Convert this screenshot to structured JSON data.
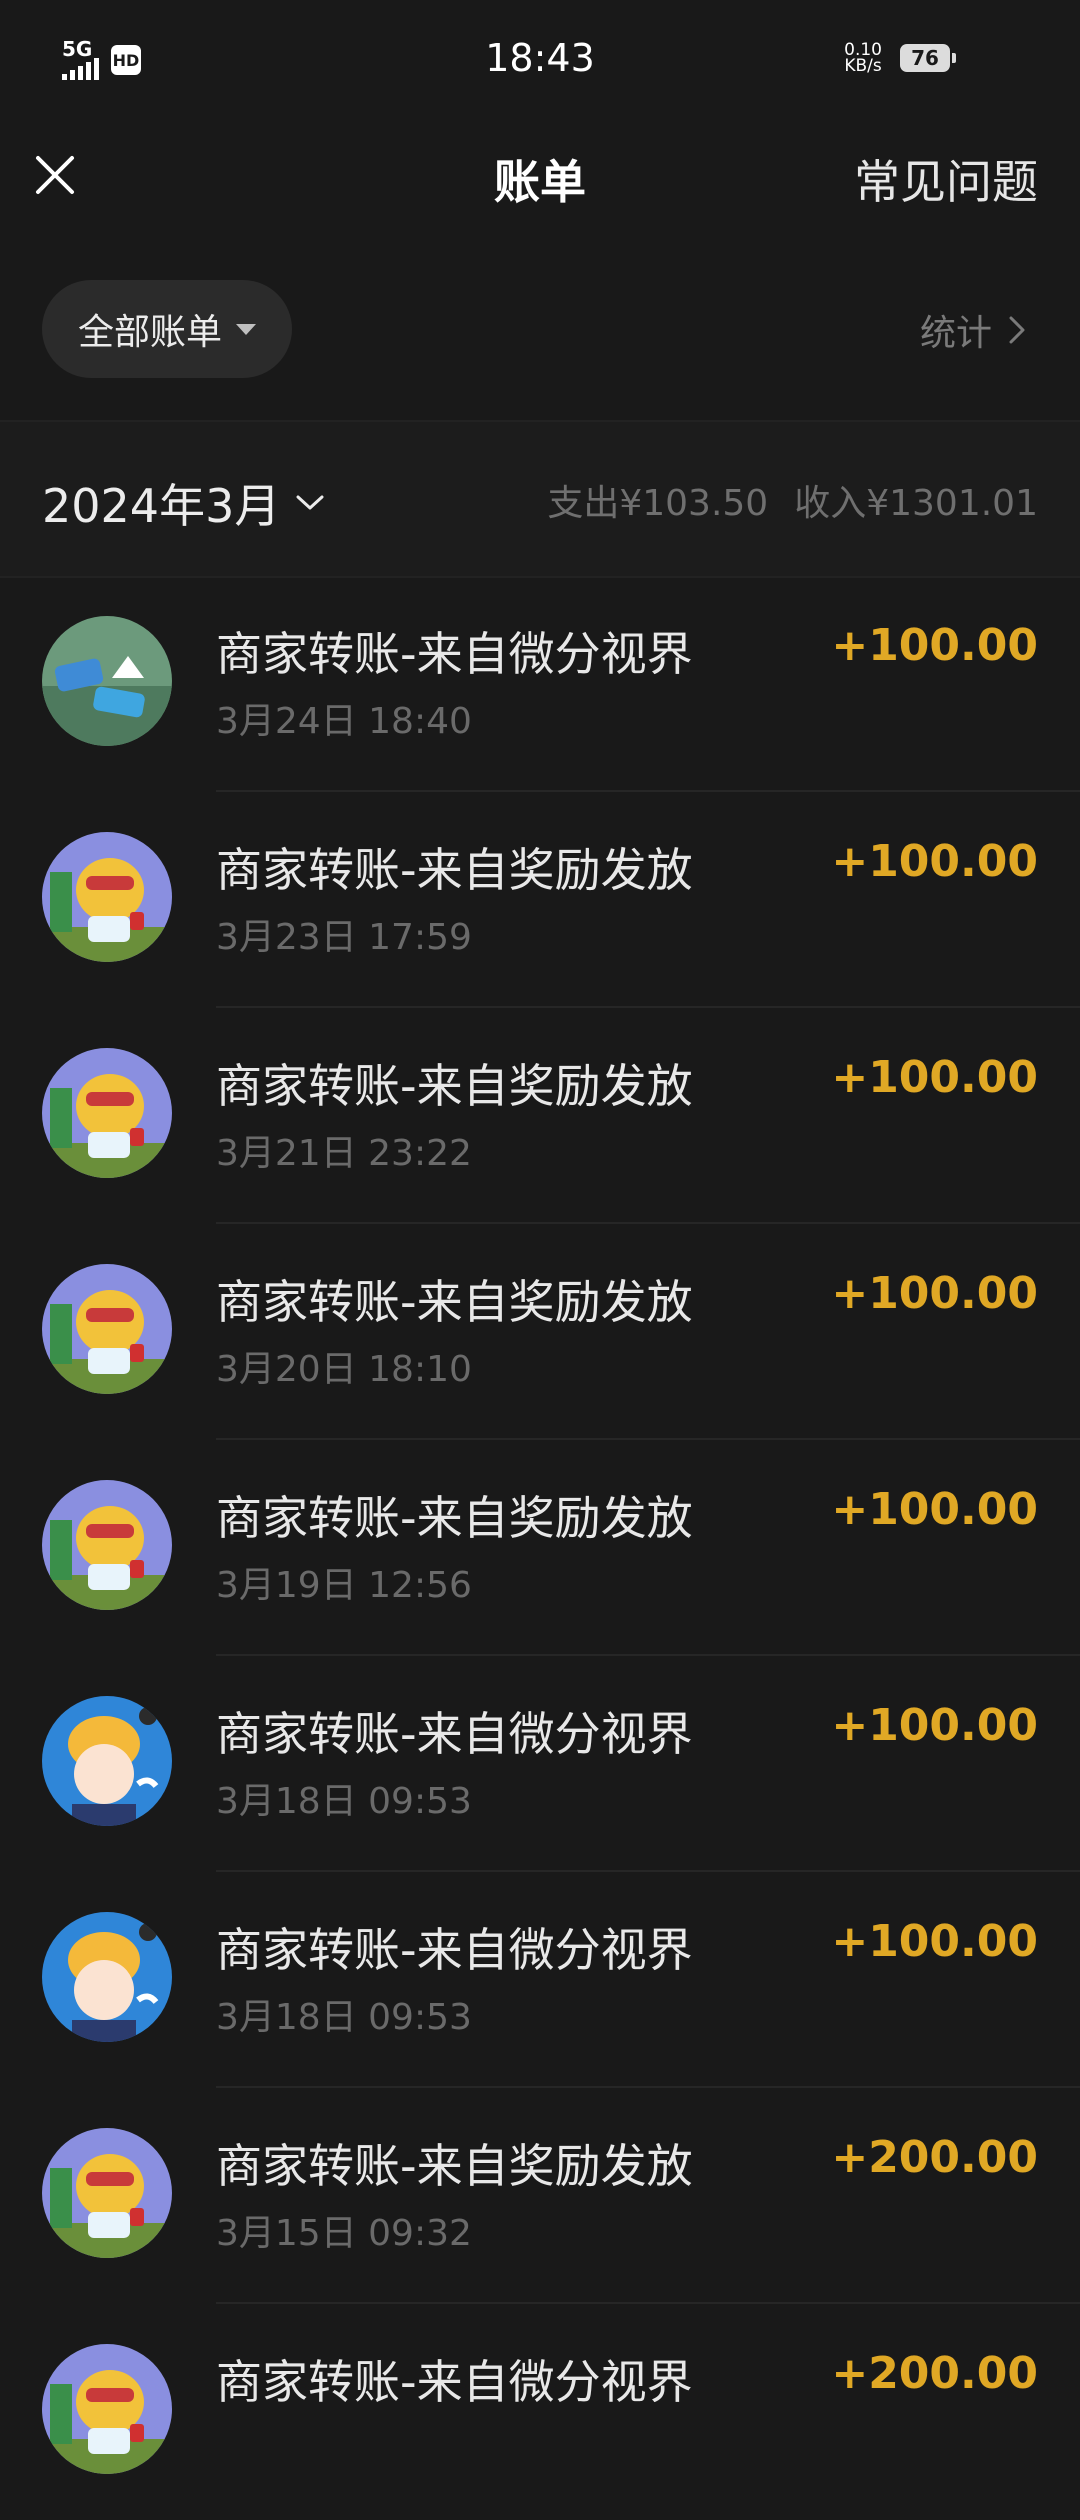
{
  "status_bar": {
    "network": "5G",
    "hd": "HD",
    "time": "18:43",
    "speed_value": "0.10",
    "speed_unit": "KB/s",
    "battery": "76"
  },
  "nav": {
    "close_icon": "close-icon",
    "title": "账单",
    "faq": "常见问题"
  },
  "filter": {
    "label": "全部账单",
    "stats": "统计"
  },
  "month": {
    "label": "2024年3月",
    "expense": "支出¥103.50",
    "income": "收入¥1301.01"
  },
  "colors": {
    "background": "#191919",
    "amount": "#e0a825",
    "secondary_text": "#6a6a6a"
  },
  "transactions": [
    {
      "title": "商家转账-来自微分视界",
      "time": "3月24日 18:40",
      "amount": "+100.00",
      "avatar": "house-badge-avatar"
    },
    {
      "title": "商家转账-来自奖励发放",
      "time": "3月23日 17:59",
      "amount": "+100.00",
      "avatar": "monkey-avatar"
    },
    {
      "title": "商家转账-来自奖励发放",
      "time": "3月21日 23:22",
      "amount": "+100.00",
      "avatar": "monkey-avatar"
    },
    {
      "title": "商家转账-来自奖励发放",
      "time": "3月20日 18:10",
      "amount": "+100.00",
      "avatar": "monkey-avatar"
    },
    {
      "title": "商家转账-来自奖励发放",
      "time": "3月19日 12:56",
      "amount": "+100.00",
      "avatar": "monkey-avatar"
    },
    {
      "title": "商家转账-来自微分视界",
      "time": "3月18日 09:53",
      "amount": "+100.00",
      "avatar": "cartoon-boy-avatar"
    },
    {
      "title": "商家转账-来自微分视界",
      "time": "3月18日 09:53",
      "amount": "+100.00",
      "avatar": "cartoon-boy-avatar"
    },
    {
      "title": "商家转账-来自奖励发放",
      "time": "3月15日 09:32",
      "amount": "+200.00",
      "avatar": "monkey-avatar"
    },
    {
      "title": "商家转账-来自微分视界",
      "time": "",
      "amount": "+200.00",
      "avatar": "monkey-avatar"
    }
  ]
}
